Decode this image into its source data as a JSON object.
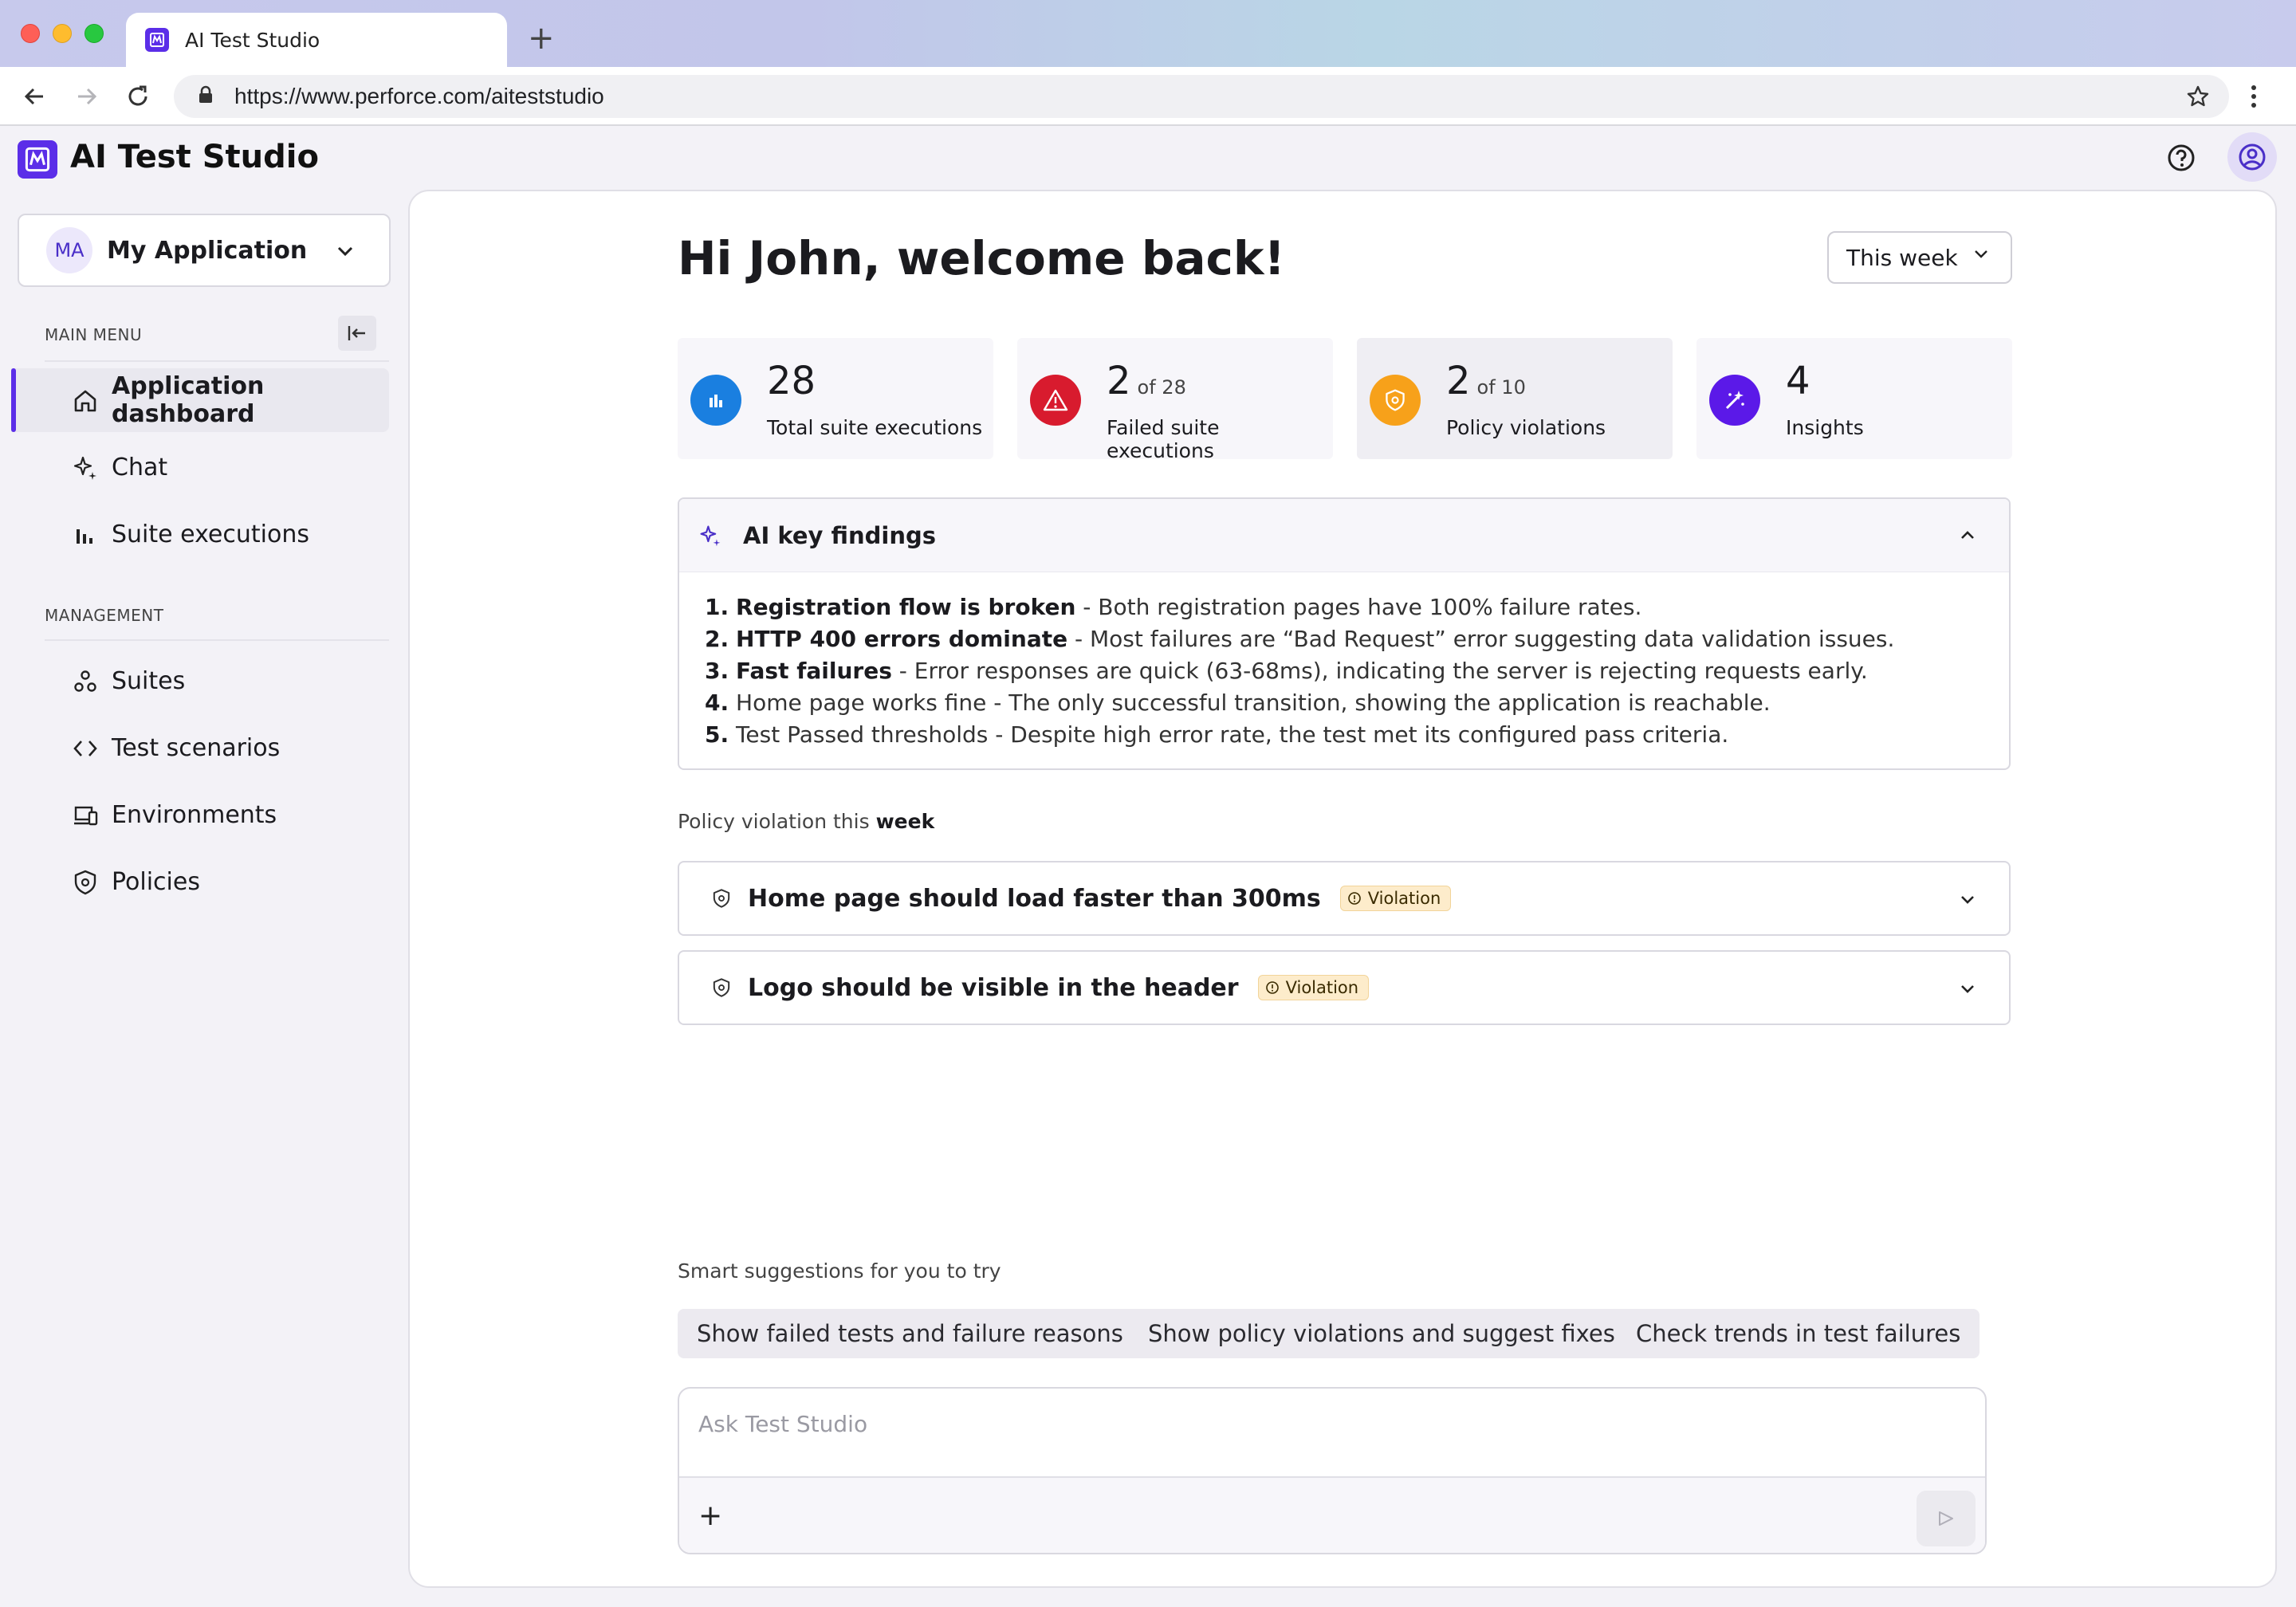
{
  "browser": {
    "tab_title": "AI Test Studio",
    "new_tab": "+",
    "url": "https://www.perforce.com/aiteststudio"
  },
  "app": {
    "title": "AI Test Studio"
  },
  "sidebar": {
    "app_avatar": "MA",
    "app_name": "My Application",
    "main_menu_label": "MAIN MENU",
    "main_items": [
      {
        "label": "Application dashboard",
        "icon": "home-icon",
        "active": true
      },
      {
        "label": "Chat",
        "icon": "sparkle-icon"
      },
      {
        "label": "Suite executions",
        "icon": "bar-chart-icon"
      }
    ],
    "management_label": "MANAGEMENT",
    "management_items": [
      {
        "label": "Suites",
        "icon": "suites-icon"
      },
      {
        "label": "Test scenarios",
        "icon": "code-icon"
      },
      {
        "label": "Environments",
        "icon": "devices-icon"
      },
      {
        "label": "Policies",
        "icon": "shield-icon"
      }
    ]
  },
  "main": {
    "greeting": "Hi John, welcome back!",
    "period": "This week",
    "stats": [
      {
        "value": "28",
        "of": "",
        "label": "Total suite executions",
        "color": "#1a7fe0",
        "icon": "bar-chart-icon"
      },
      {
        "value": "2",
        "of": "of 28",
        "label": "Failed suite executions",
        "color": "#d81b2e",
        "icon": "warning-icon"
      },
      {
        "value": "2",
        "of": "of 10",
        "label": "Policy violations",
        "color": "#f7a11a",
        "icon": "shield-icon"
      },
      {
        "value": "4",
        "of": "",
        "label": "Insights",
        "color": "#5b19e8",
        "icon": "magic-wand-icon"
      }
    ],
    "findings": {
      "title": "AI key findings",
      "items": [
        {
          "num": "1.",
          "bold": "Registration flow is broken",
          "text": " - Both registration pages have 100% failure rates."
        },
        {
          "num": "2.",
          "bold": "HTTP 400 errors dominate",
          "text": " - Most failures are “Bad Request” error suggesting data validation issues."
        },
        {
          "num": "3.",
          "bold": "Fast failures",
          "text": " - Error responses are quick (63-68ms), indicating the server is rejecting requests early."
        },
        {
          "num": "4.",
          "bold": "",
          "text": "Home page works fine - The only successful transition, showing the application is reachable."
        },
        {
          "num": "5.",
          "bold": "",
          "text": "Test Passed thresholds - Despite high error rate, the test met its configured pass criteria."
        }
      ]
    },
    "policy_section_label": "Policy violation this",
    "policy_section_label_bold": "week",
    "policies": [
      {
        "title": "Home page should load faster than 300ms",
        "badge": "Violation"
      },
      {
        "title": "Logo should be visible in the header",
        "badge": "Violation"
      }
    ],
    "smart_label": "Smart suggestions for you to try",
    "suggestions": [
      "Show failed tests and failure reasons",
      "Show policy violations and suggest fixes",
      "Check trends in test failures"
    ],
    "chat_placeholder": "Ask Test Studio",
    "chat_plus": "+"
  }
}
